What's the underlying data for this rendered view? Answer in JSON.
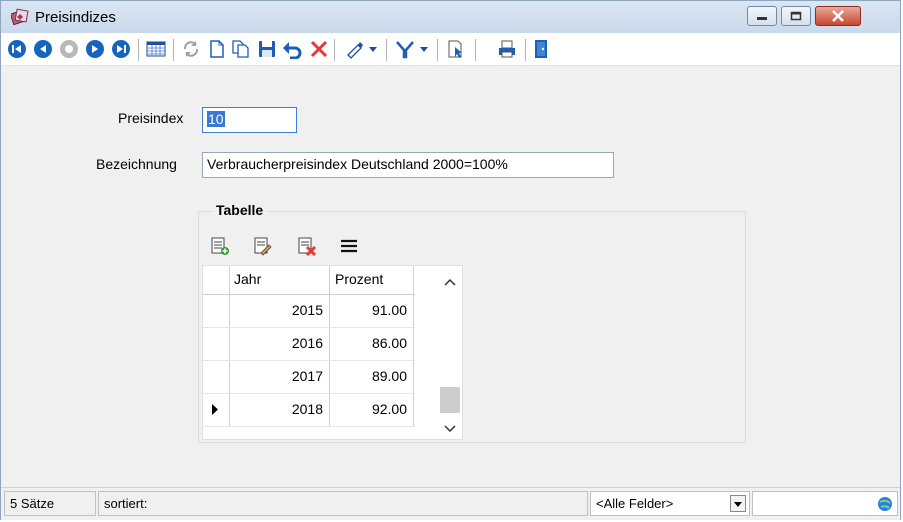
{
  "window": {
    "title": "Preisindizes",
    "icon": "cards-icon"
  },
  "toolbar": {
    "buttons": [
      "first-record",
      "previous-record",
      "stop",
      "next-record",
      "last-record",
      "calendar-grid",
      "refresh",
      "new",
      "copy",
      "save",
      "undo",
      "delete",
      "edit-pen",
      "filter",
      "export",
      "print",
      "exit"
    ]
  },
  "form": {
    "preisindex_label": "Preisindex",
    "preisindex_value": "10",
    "bezeichnung_label": "Bezeichnung",
    "bezeichnung_value": "Verbraucherpreisindex Deutschland 2000=100%"
  },
  "table": {
    "group_title": "Tabelle",
    "columns": [
      "Jahr",
      "Prozent"
    ],
    "rows": [
      {
        "jahr": "2015",
        "prozent": "91.00"
      },
      {
        "jahr": "2016",
        "prozent": "86.00"
      },
      {
        "jahr": "2017",
        "prozent": "89.00"
      },
      {
        "jahr": "2018",
        "prozent": "92.00"
      }
    ],
    "current_row": 3
  },
  "statusbar": {
    "count": "5 Sätze",
    "sorted": "sortiert:",
    "field_select": "<Alle Felder>"
  },
  "colors": {
    "nav_blue": "#1565c0",
    "delete_red": "#e53935",
    "filter_blue": "#1e5fb3",
    "close_red": "#c9472f"
  }
}
